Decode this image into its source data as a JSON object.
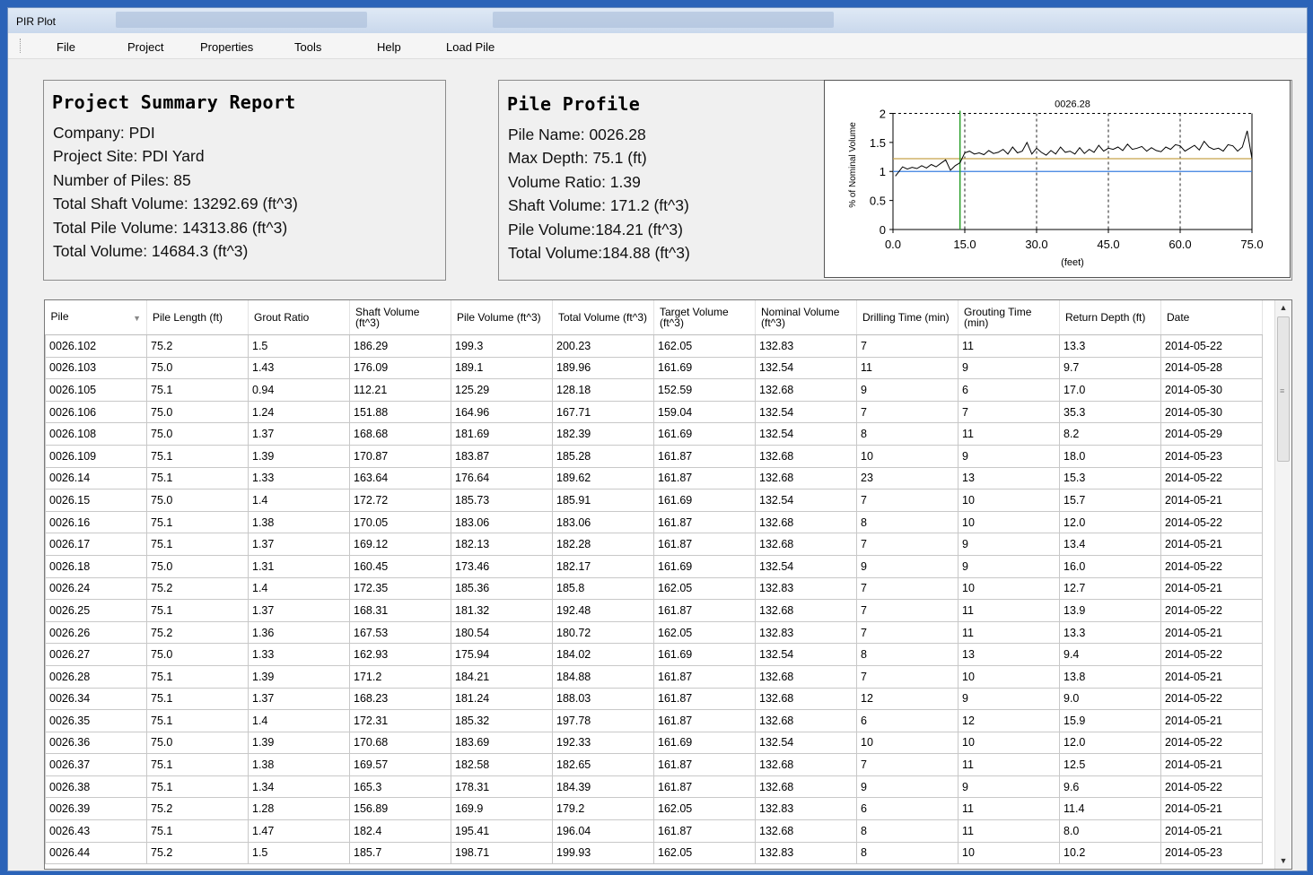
{
  "window": {
    "title": "PIR Plot"
  },
  "menu": [
    "File",
    "Project",
    "Properties",
    "Tools",
    "Help",
    "Load Pile"
  ],
  "summary": {
    "heading": "Project Summary Report",
    "lines": [
      "Company: PDI",
      "Project Site: PDI Yard",
      "Number of Piles: 85",
      "Total Shaft Volume: 13292.69 (ft^3)",
      "Total Pile Volume: 14313.86 (ft^3)",
      "Total Volume: 14684.3 (ft^3)"
    ]
  },
  "profile": {
    "heading": "Pile Profile",
    "lines": [
      "Pile Name: 0026.28",
      "Max Depth: 75.1 (ft)",
      "Volume Ratio: 1.39",
      "Shaft Volume: 171.2 (ft^3)",
      "Pile Volume:184.21 (ft^3)",
      "Total Volume:184.88 (ft^3)"
    ]
  },
  "chart_data": {
    "type": "line",
    "title": "0026.28",
    "xlabel": "(feet)",
    "ylabel": "% of Nominal Volume",
    "xlim": [
      0,
      75
    ],
    "ylim": [
      0,
      2.1
    ],
    "xticks": [
      "0.0",
      "15.0",
      "30.0",
      "45.0",
      "60.0",
      "75.0"
    ],
    "yticks": [
      "0",
      "0.5",
      "1",
      "1.5",
      "2"
    ],
    "vertical_markers": [
      14
    ],
    "reference_lines": [
      {
        "y": 1.0,
        "color": "#3a7fe0"
      },
      {
        "y": 1.22,
        "color": "#c8a24a"
      }
    ],
    "marker_color": "#2ca02c",
    "series_color": "#000000",
    "x": [
      0.5,
      2,
      3,
      4,
      5,
      6,
      7,
      8,
      9,
      10,
      11,
      12,
      13,
      14,
      15,
      16,
      17,
      18,
      19,
      20,
      21,
      22,
      23,
      24,
      25,
      26,
      27,
      28,
      29,
      30,
      31,
      32,
      33,
      34,
      35,
      36,
      37,
      38,
      39,
      40,
      41,
      42,
      43,
      44,
      45,
      46,
      47,
      48,
      49,
      50,
      51,
      52,
      53,
      54,
      55,
      56,
      57,
      58,
      59,
      60,
      61,
      62,
      63,
      64,
      65,
      66,
      67,
      68,
      69,
      70,
      71,
      72,
      73,
      74,
      75
    ],
    "y": [
      0.92,
      1.08,
      1.04,
      1.07,
      1.05,
      1.1,
      1.06,
      1.12,
      1.08,
      1.14,
      1.2,
      1.02,
      1.1,
      1.15,
      1.32,
      1.35,
      1.3,
      1.32,
      1.29,
      1.36,
      1.31,
      1.33,
      1.38,
      1.3,
      1.42,
      1.32,
      1.35,
      1.5,
      1.3,
      1.4,
      1.33,
      1.28,
      1.36,
      1.3,
      1.42,
      1.33,
      1.35,
      1.3,
      1.41,
      1.31,
      1.38,
      1.33,
      1.45,
      1.35,
      1.4,
      1.38,
      1.42,
      1.36,
      1.47,
      1.38,
      1.4,
      1.43,
      1.35,
      1.41,
      1.36,
      1.34,
      1.42,
      1.38,
      1.46,
      1.44,
      1.35,
      1.4,
      1.45,
      1.37,
      1.52,
      1.42,
      1.38,
      1.4,
      1.35,
      1.46,
      1.44,
      1.35,
      1.42,
      1.7,
      1.22
    ],
    "grid": "dashed vertical lines at 15, 30, 45, 60; dashed top line at 2"
  },
  "table": {
    "columns": [
      "Pile",
      "Pile Length (ft)",
      "Grout Ratio",
      "Shaft Volume (ft^3)",
      "Pile Volume (ft^3)",
      "Total Volume (ft^3)",
      "Target Volume (ft^3)",
      "Nominal Volume (ft^3)",
      "Drilling Time (min)",
      "Grouting Time (min)",
      "Return Depth (ft)",
      "Date"
    ],
    "rows": [
      [
        "0026.102",
        "75.2",
        "1.5",
        "186.29",
        "199.3",
        "200.23",
        "162.05",
        "132.83",
        "7",
        "11",
        "13.3",
        "2014-05-22"
      ],
      [
        "0026.103",
        "75.0",
        "1.43",
        "176.09",
        "189.1",
        "189.96",
        "161.69",
        "132.54",
        "11",
        "9",
        "9.7",
        "2014-05-28"
      ],
      [
        "0026.105",
        "75.1",
        "0.94",
        "112.21",
        "125.29",
        "128.18",
        "152.59",
        "132.68",
        "9",
        "6",
        "17.0",
        "2014-05-30"
      ],
      [
        "0026.106",
        "75.0",
        "1.24",
        "151.88",
        "164.96",
        "167.71",
        "159.04",
        "132.54",
        "7",
        "7",
        "35.3",
        "2014-05-30"
      ],
      [
        "0026.108",
        "75.0",
        "1.37",
        "168.68",
        "181.69",
        "182.39",
        "161.69",
        "132.54",
        "8",
        "11",
        "8.2",
        "2014-05-29"
      ],
      [
        "0026.109",
        "75.1",
        "1.39",
        "170.87",
        "183.87",
        "185.28",
        "161.87",
        "132.68",
        "10",
        "9",
        "18.0",
        "2014-05-23"
      ],
      [
        "0026.14",
        "75.1",
        "1.33",
        "163.64",
        "176.64",
        "189.62",
        "161.87",
        "132.68",
        "23",
        "13",
        "15.3",
        "2014-05-22"
      ],
      [
        "0026.15",
        "75.0",
        "1.4",
        "172.72",
        "185.73",
        "185.91",
        "161.69",
        "132.54",
        "7",
        "10",
        "15.7",
        "2014-05-21"
      ],
      [
        "0026.16",
        "75.1",
        "1.38",
        "170.05",
        "183.06",
        "183.06",
        "161.87",
        "132.68",
        "8",
        "10",
        "12.0",
        "2014-05-22"
      ],
      [
        "0026.17",
        "75.1",
        "1.37",
        "169.12",
        "182.13",
        "182.28",
        "161.87",
        "132.68",
        "7",
        "9",
        "13.4",
        "2014-05-21"
      ],
      [
        "0026.18",
        "75.0",
        "1.31",
        "160.45",
        "173.46",
        "182.17",
        "161.69",
        "132.54",
        "9",
        "9",
        "16.0",
        "2014-05-22"
      ],
      [
        "0026.24",
        "75.2",
        "1.4",
        "172.35",
        "185.36",
        "185.8",
        "162.05",
        "132.83",
        "7",
        "10",
        "12.7",
        "2014-05-21"
      ],
      [
        "0026.25",
        "75.1",
        "1.37",
        "168.31",
        "181.32",
        "192.48",
        "161.87",
        "132.68",
        "7",
        "11",
        "13.9",
        "2014-05-22"
      ],
      [
        "0026.26",
        "75.2",
        "1.36",
        "167.53",
        "180.54",
        "180.72",
        "162.05",
        "132.83",
        "7",
        "11",
        "13.3",
        "2014-05-21"
      ],
      [
        "0026.27",
        "75.0",
        "1.33",
        "162.93",
        "175.94",
        "184.02",
        "161.69",
        "132.54",
        "8",
        "13",
        "9.4",
        "2014-05-22"
      ],
      [
        "0026.28",
        "75.1",
        "1.39",
        "171.2",
        "184.21",
        "184.88",
        "161.87",
        "132.68",
        "7",
        "10",
        "13.8",
        "2014-05-21"
      ],
      [
        "0026.34",
        "75.1",
        "1.37",
        "168.23",
        "181.24",
        "188.03",
        "161.87",
        "132.68",
        "12",
        "9",
        "9.0",
        "2014-05-22"
      ],
      [
        "0026.35",
        "75.1",
        "1.4",
        "172.31",
        "185.32",
        "197.78",
        "161.87",
        "132.68",
        "6",
        "12",
        "15.9",
        "2014-05-21"
      ],
      [
        "0026.36",
        "75.0",
        "1.39",
        "170.68",
        "183.69",
        "192.33",
        "161.69",
        "132.54",
        "10",
        "10",
        "12.0",
        "2014-05-22"
      ],
      [
        "0026.37",
        "75.1",
        "1.38",
        "169.57",
        "182.58",
        "182.65",
        "161.87",
        "132.68",
        "7",
        "11",
        "12.5",
        "2014-05-21"
      ],
      [
        "0026.38",
        "75.1",
        "1.34",
        "165.3",
        "178.31",
        "184.39",
        "161.87",
        "132.68",
        "9",
        "9",
        "9.6",
        "2014-05-22"
      ],
      [
        "0026.39",
        "75.2",
        "1.28",
        "156.89",
        "169.9",
        "179.2",
        "162.05",
        "132.83",
        "6",
        "11",
        "11.4",
        "2014-05-21"
      ],
      [
        "0026.43",
        "75.1",
        "1.47",
        "182.4",
        "195.41",
        "196.04",
        "161.87",
        "132.68",
        "8",
        "11",
        "8.0",
        "2014-05-21"
      ],
      [
        "0026.44",
        "75.2",
        "1.5",
        "185.7",
        "198.71",
        "199.93",
        "162.05",
        "132.83",
        "8",
        "10",
        "10.2",
        "2014-05-23"
      ]
    ]
  }
}
